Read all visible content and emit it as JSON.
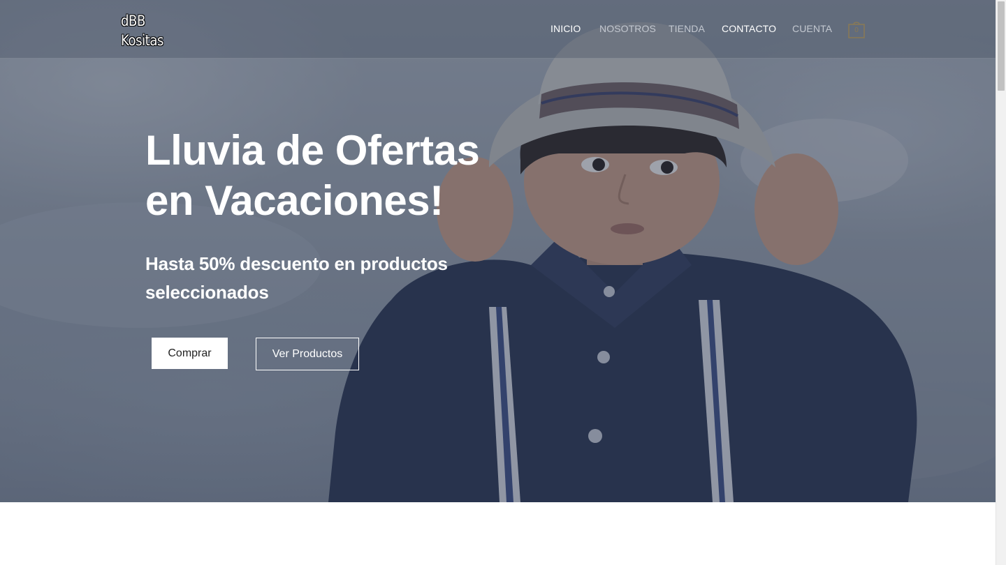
{
  "header": {
    "logo": {
      "line1": "dBB",
      "line2": "Kositas"
    },
    "nav": [
      {
        "label": "INICIO",
        "state": "active"
      },
      {
        "label": "NOSOTROS",
        "state": "muted"
      },
      {
        "label": "TIENDA",
        "state": "muted"
      },
      {
        "label": "CONTACTO",
        "state": "bright"
      },
      {
        "label": "CUENTA",
        "state": "muted"
      }
    ],
    "cart": {
      "icon": "shopping-bag-icon",
      "count": "0"
    }
  },
  "hero": {
    "title_line1": "Lluvia de Ofertas",
    "title_line2": "en Vacaciones!",
    "subtitle_line1": "Hasta 50% descuento en productos",
    "subtitle_line2": "seleccionados",
    "primary_button": "Comprar",
    "secondary_button": "Ver Productos",
    "overlay_color": "#2c3850",
    "image_description_icon": "child-with-hat-photo"
  },
  "colors": {
    "text_light": "#ffffff",
    "nav_muted": "#c3c8d0",
    "button_bg": "#ffffff",
    "button_text": "#222222",
    "cart_accent": "#8a7a55"
  }
}
